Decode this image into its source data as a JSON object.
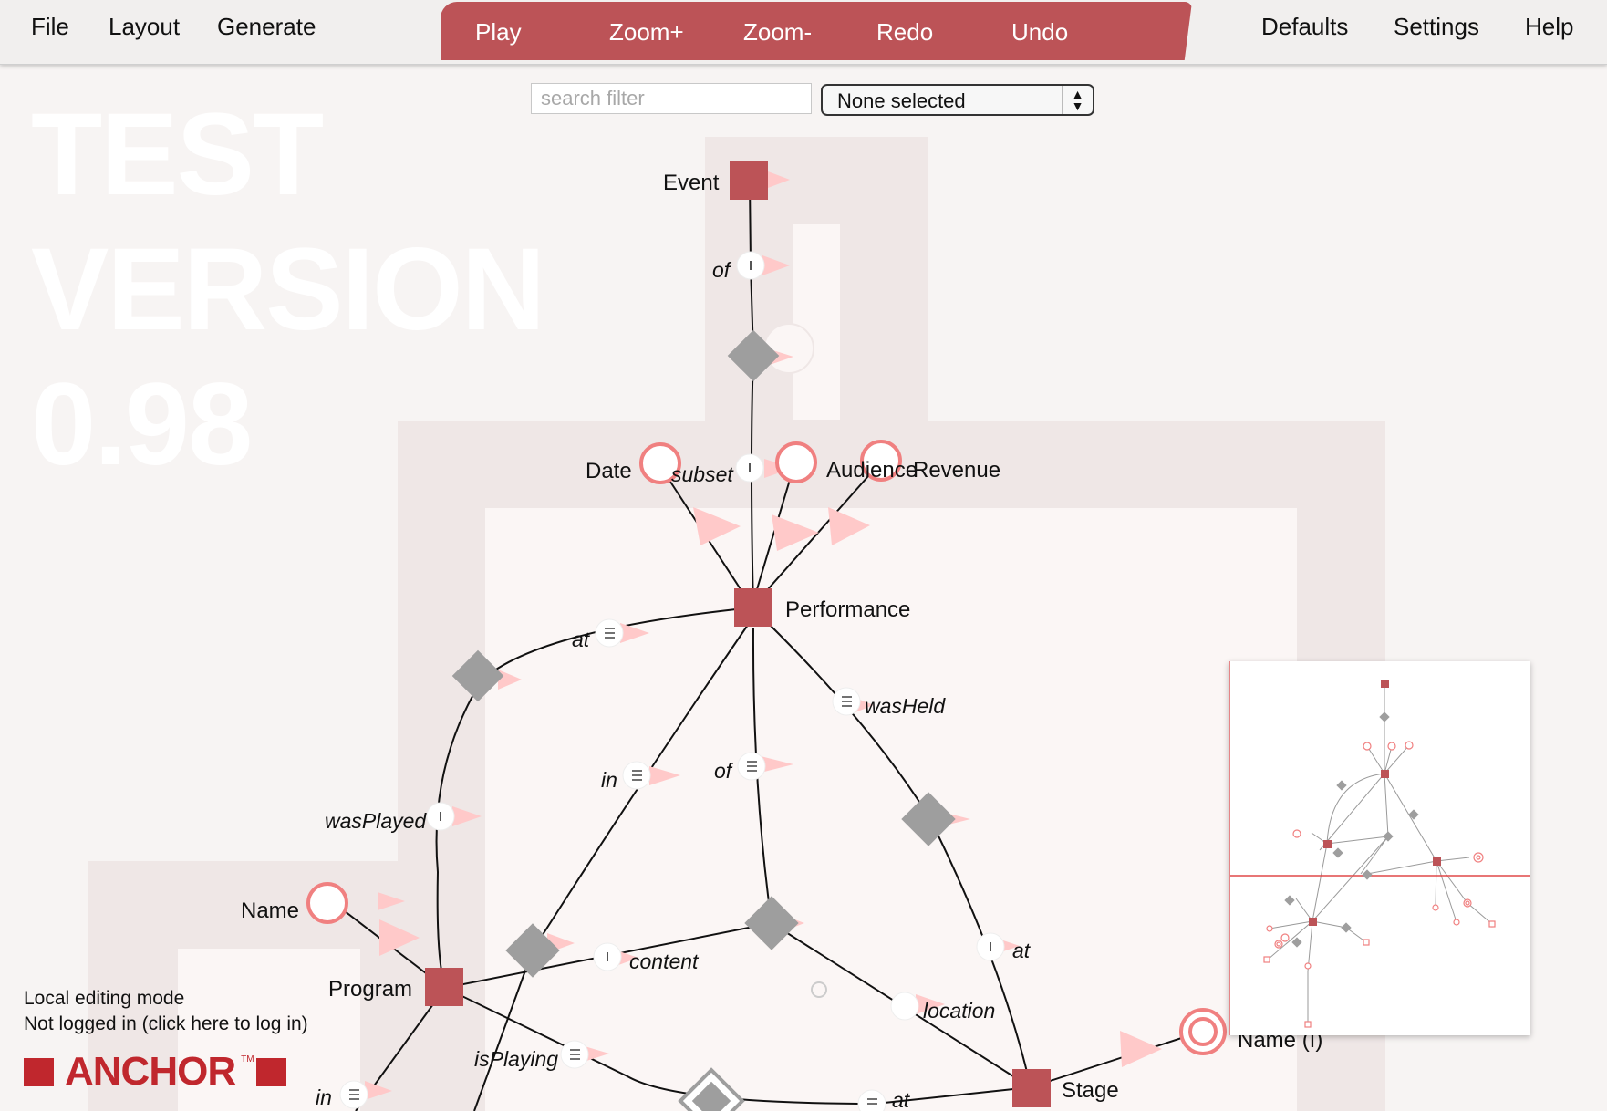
{
  "menu": {
    "file": "File",
    "layout": "Layout",
    "generate": "Generate",
    "defaults": "Defaults",
    "settings": "Settings",
    "help": "Help"
  },
  "toolbar": {
    "play": "Play",
    "zoom_in": "Zoom+",
    "zoom_out": "Zoom-",
    "redo": "Redo",
    "undo": "Undo"
  },
  "watermark": [
    "TEST",
    "VERSION",
    "0.98"
  ],
  "search": {
    "placeholder": "search filter"
  },
  "select": {
    "value": "None selected"
  },
  "colors": {
    "accent": "#bc5357",
    "anchor": "#c0272d",
    "tie": "#9e9e9e",
    "attribute_ring": "#f08080"
  },
  "graph": {
    "anchors": {
      "event": "Event",
      "performance": "Performance",
      "program": "Program",
      "stage": "Stage"
    },
    "attributes": {
      "date": "Date",
      "audience": "Audience",
      "revenue": "Revenue",
      "name": "Name",
      "stage_name": "Name (I)"
    },
    "roles": {
      "of_top": "of",
      "subset": "subset",
      "at_left": "at",
      "in_mid": "in",
      "of_mid": "of",
      "wasHeld": "wasHeld",
      "wasPlayed": "wasPlayed",
      "content": "content",
      "location": "location",
      "at_right": "at",
      "isPlaying": "isPlaying",
      "in_bottom": "in",
      "at_bottom": "at"
    }
  },
  "status": {
    "mode": "Local editing mode",
    "login": "Not logged in (click here to log in)"
  },
  "logo": {
    "text": "ANCHOR",
    "tm": "TM"
  }
}
